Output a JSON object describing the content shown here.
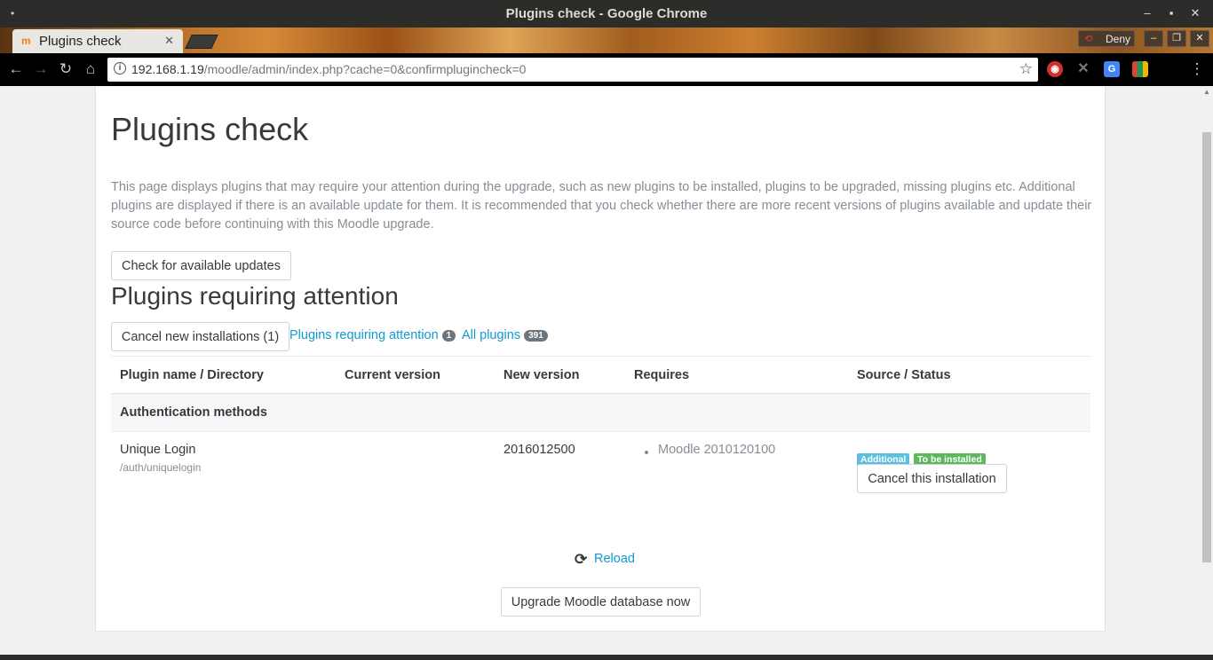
{
  "window": {
    "title": "Plugins check - Google Chrome",
    "dot": "•",
    "minimize": "–",
    "maximize": "▪",
    "close": "✕"
  },
  "tab": {
    "title": "Plugins check",
    "favicon": "m",
    "close": "✕"
  },
  "extensions_bar": {
    "deny_label": "Deny"
  },
  "omnibox": {
    "url_host": "192.168.1.19",
    "url_path": "/moodle/admin/index.php?cache=0&confirmplugincheck=0"
  },
  "page": {
    "title": "Plugins check",
    "intro": "This page displays plugins that may require your attention during the upgrade, such as new plugins to be installed, plugins to be upgraded, missing plugins etc. Additional plugins are displayed if there is an available update for them. It is recommended that you check whether there are more recent versions of plugins available and update their source code before continuing with this Moodle upgrade.",
    "check_updates_button": "Check for available updates",
    "section_title": "Plugins requiring attention",
    "cancel_new_button": "Cancel new installations (1)",
    "filter_attention_label": "Plugins requiring attention",
    "filter_attention_count": "1",
    "filter_all_label": "All plugins",
    "filter_all_count": "391",
    "table": {
      "headers": [
        "Plugin name / Directory",
        "Current version",
        "New version",
        "Requires",
        "Source / Status"
      ],
      "group": "Authentication methods",
      "rows": [
        {
          "name": "Unique Login",
          "directory": "/auth/uniquelogin",
          "current_version": "",
          "new_version": "2016012500",
          "requires": "Moodle 2010120100",
          "source_badge": "Additional",
          "status_badge": "To be installed",
          "cancel_button": "Cancel this installation"
        }
      ]
    },
    "reload_label": "Reload",
    "upgrade_button": "Upgrade Moodle database now"
  },
  "colors": {
    "accent_link": "#0f9ad2",
    "badge_additional": "#5bc0de",
    "badge_to_be_installed": "#5cb85c",
    "count_badge": "#6c757d"
  }
}
